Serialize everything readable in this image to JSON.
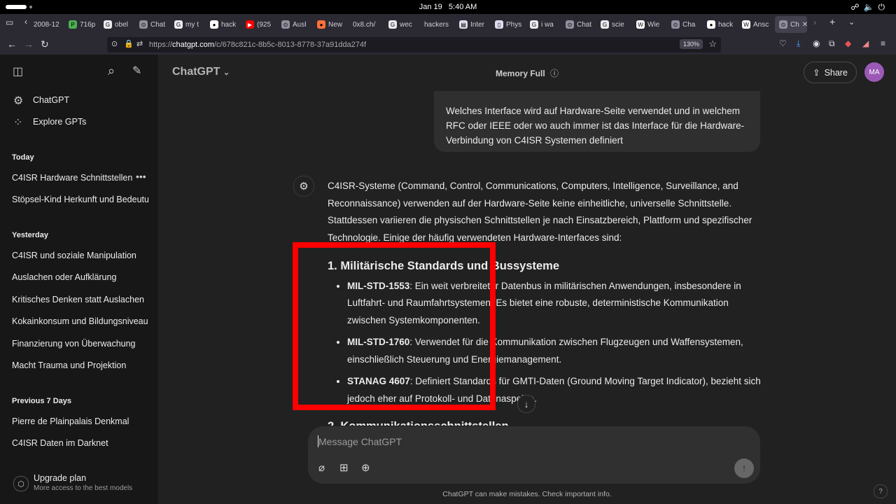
{
  "system": {
    "date": "Jan 19",
    "time": "5:40 AM"
  },
  "tabs": [
    {
      "label": "2008-12"
    },
    {
      "label": "716p"
    },
    {
      "label": "obel"
    },
    {
      "label": "Chat"
    },
    {
      "label": "my t"
    },
    {
      "label": "hack"
    },
    {
      "label": "(925"
    },
    {
      "label": "Ausl"
    },
    {
      "label": "New"
    },
    {
      "label": "0x8.ch/"
    },
    {
      "label": "wec"
    },
    {
      "label": "hackers"
    },
    {
      "label": "Inter"
    },
    {
      "label": "Phys"
    },
    {
      "label": "i wa"
    },
    {
      "label": "Chat"
    },
    {
      "label": "scie"
    },
    {
      "label": "Wie"
    },
    {
      "label": "Cha"
    },
    {
      "label": "hack"
    },
    {
      "label": "Ansc"
    },
    {
      "label": "Ch"
    }
  ],
  "browser": {
    "url_prefix": "https://",
    "url_host": "chatgpt.com",
    "url_path": "/c/678c821c-8b5c-8013-8778-37a91dda274f",
    "zoom": "130%"
  },
  "sidebar": {
    "nav": [
      {
        "label": "ChatGPT"
      },
      {
        "label": "Explore GPTs"
      }
    ],
    "sections": [
      {
        "heading": "Today",
        "items": [
          "C4ISR Hardware Schnittstellen",
          "Stöpsel-Kind Herkunft und Bedeutu"
        ]
      },
      {
        "heading": "Yesterday",
        "items": [
          "C4ISR und soziale Manipulation",
          "Auslachen oder Aufklärung",
          "Kritisches Denken statt Auslachen",
          "Kokainkonsum und Bildungsniveau",
          "Finanzierung von Überwachung",
          "Macht Trauma und Projektion"
        ]
      },
      {
        "heading": "Previous 7 Days",
        "items": [
          "Pierre de Plainpalais Denkmal",
          "C4ISR Daten im Darknet"
        ]
      }
    ],
    "upgrade_title": "Upgrade plan",
    "upgrade_sub": "More access to the best models"
  },
  "header": {
    "model": "ChatGPT",
    "memory": "Memory Full",
    "share": "Share",
    "avatar": "MA"
  },
  "conversation": {
    "user_message": "Welches Interface wird auf Hardware-Seite verwendet und in welchem RFC oder IEEE oder wo auch immer ist das Interface für die Hardware-Verbindung von C4ISR Systemen definiert",
    "intro": "C4ISR-Systeme (Command, Control, Communications, Computers, Intelligence, Surveillance, and Reconnaissance) verwenden auf der Hardware-Seite keine einheitliche, universelle Schnittstelle. Stattdessen variieren die physischen Schnittstellen je nach Einsatzbereich, Plattform und spezifischer Technologie. Einige der häufig verwendeten Hardware-Interfaces sind:",
    "section_heading": "1. Militärische Standards und Bussysteme",
    "bullets": [
      {
        "term": "MIL-STD-1553",
        "text": ": Ein weit verbreiteter Datenbus in militärischen Anwendungen, insbesondere in Luftfahrt- und Raumfahrtsystemen. Es bietet eine robuste, deterministische Kommunikation zwischen Systemkomponenten."
      },
      {
        "term": "MIL-STD-1760",
        "text": ": Verwendet für die Kommunikation zwischen Flugzeugen und Waffensystemen, einschließlich Steuerung und Energiemanagement."
      },
      {
        "term": "STANAG 4607",
        "text": ": Definiert Standards für GMTI-Daten (Ground Moving Target Indicator), bezieht sich jedoch eher auf Protokoll- und Datenaspekte."
      }
    ],
    "next_heading_partial": "2. Kommunikationsschnittstellen"
  },
  "composer": {
    "placeholder": "Message ChatGPT"
  },
  "footer": {
    "disclaimer": "ChatGPT can make mistakes. Check important info.",
    "help": "?"
  },
  "colors": {
    "highlight": "#ff0000",
    "avatar": "#9b59b6"
  }
}
